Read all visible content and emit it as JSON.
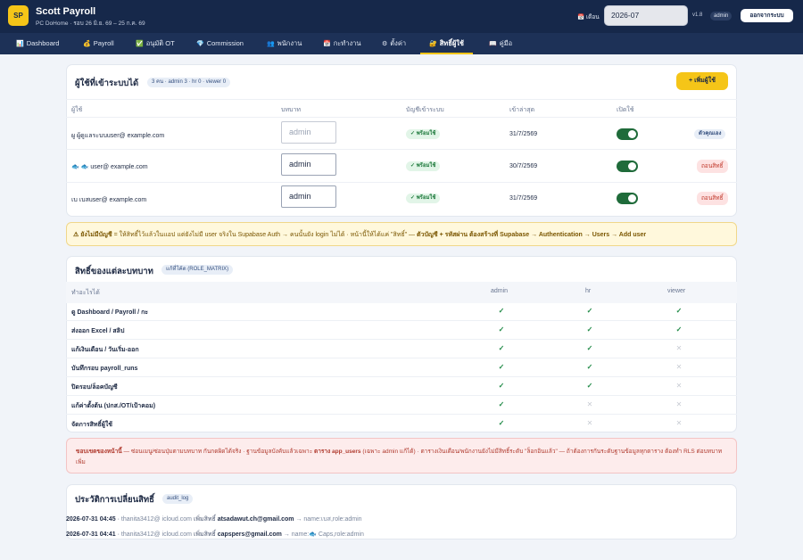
{
  "header": {
    "logo": "SP",
    "title": "Scott Payroll",
    "subtitle": "PC DoHome · รอบ 26 มิ.ย. 69 – 25 ก.ค. 69",
    "month_label": "เดือน",
    "month_value": "2026-07",
    "version": "v1.8",
    "role": "admin",
    "logout": "ออกจากระบบ"
  },
  "nav": [
    {
      "icon": "📊",
      "label": "Dashboard",
      "active": false
    },
    {
      "icon": "💰",
      "label": "Payroll",
      "active": false
    },
    {
      "icon": "✅",
      "label": "อนุมัติ OT",
      "active": false
    },
    {
      "icon": "💎",
      "label": "Commission",
      "active": false
    },
    {
      "icon": "👥",
      "label": "พนักงาน",
      "active": false
    },
    {
      "icon": "📅",
      "label": "กะทำงาน",
      "active": false
    },
    {
      "icon": "⚙",
      "label": "ตั้งค่า",
      "active": false
    },
    {
      "icon": "🔐",
      "label": "สิทธิ์ผู้ใช้",
      "active": true
    },
    {
      "icon": "📖",
      "label": "คู่มือ",
      "active": false
    }
  ],
  "users": {
    "title": "ผู้ใช้ที่เข้าระบบได้",
    "summary": "3 คน · admin 3 · hr 0 · viewer 0",
    "add_button": "+ เพิ่มผู้ใช้",
    "columns": [
      "ผู้ใช้",
      "บทบาท",
      "บัญชีเข้าระบบ",
      "เข้าล่าสุด",
      "เปิดใช้"
    ],
    "rows": [
      {
        "user": "ผู ผู้ดูแลระบบuser@ example.com",
        "role": "admin",
        "role_placeholder": true,
        "status": "✓ พร้อมใช้",
        "last": "31/7/2569",
        "action": "ตัวคุณเอง",
        "action_type": "self"
      },
      {
        "user": "🐟 🐟 user@ example.com",
        "role": "admin",
        "role_placeholder": false,
        "status": "✓ พร้อมใช้",
        "last": "30/7/2569",
        "action": "ถอนสิทธิ์",
        "action_type": "revoke"
      },
      {
        "user": "เบ เบสuser@ example.com",
        "role": "admin",
        "role_placeholder": false,
        "status": "✓ พร้อมใช้",
        "last": "31/7/2569",
        "action": "ถอนสิทธิ์",
        "action_type": "revoke"
      }
    ]
  },
  "warning": {
    "lead": "⚠ ยังไม่มีบัญชี",
    "text": " = ให้สิทธิ์ไว้แล้วในแอป แต่ยังไม่มี user จริงใน Supabase Auth → คนนั้นยัง login ไม่ได้ · หน้านี้ให้ได้แค่ \"สิทธิ์\" — ",
    "bold": "ตัวบัญชี + รหัสผ่าน ต้องสร้างที่ Supabase → Authentication → Users → Add user"
  },
  "matrix": {
    "title": "สิทธิ์ของแต่ละบทบาท",
    "tag": "แก้ที่โค้ด (ROLE_MATRIX)",
    "columns": [
      "ทำอะไรได้",
      "admin",
      "hr",
      "viewer"
    ],
    "rows": [
      {
        "label": "ดู Dashboard / Payroll / กะ",
        "admin": "✓",
        "hr": "✓",
        "viewer": "✓"
      },
      {
        "label": "ส่งออก Excel / สลิป",
        "admin": "✓",
        "hr": "✓",
        "viewer": "✓"
      },
      {
        "label": "แก้เงินเดือน / วันเริ่ม-ออก",
        "admin": "✓",
        "hr": "✓",
        "viewer": "✕"
      },
      {
        "label": "บันทึกรอบ payroll_runs",
        "admin": "✓",
        "hr": "✓",
        "viewer": "✕"
      },
      {
        "label": "ปิดรอบ/ล็อคบัญชี",
        "admin": "✓",
        "hr": "✓",
        "viewer": "✕"
      },
      {
        "label": "แก้ค่าตั้งต้น (ปกส./OT/เป้าคอม)",
        "admin": "✓",
        "hr": "✕",
        "viewer": "✕"
      },
      {
        "label": "จัดการสิทธิ์ผู้ใช้",
        "admin": "✓",
        "hr": "✕",
        "viewer": "✕"
      }
    ]
  },
  "note": {
    "lead": "ขอบเขตของหน้านี้",
    "text1": " — ซ่อนเมนู/ซ่อนปุ่มตามบทบาท กันกดผิดได้จริง · ฐานข้อมูลบังคับแล้วเฉพาะ ",
    "bold2": "ตาราง app_users",
    "text2": " (เฉพาะ admin แก้ได้) · ตารางเงินเดือน/พนักงานยังไม่มีสิทธิ์ระดับ \"ล็อกอินแล้ว\" — ถ้าต้องการกันระดับฐานข้อมูลทุกตาราง ต้องทำ RLS ต่อบทบาทเพิ่ม"
  },
  "audit": {
    "title": "ประวัติการเปลี่ยนสิทธิ์",
    "tag": "audit_log",
    "entries": [
      {
        "ts": "2026-07-31 04:45",
        "actor": "thanita3412@ icloud.com",
        "action": "เพิ่มสิทธิ์",
        "email": "atsadawut.ch@gmail.com",
        "result": "→ name:เบส,role:admin"
      },
      {
        "ts": "2026-07-31 04:41",
        "actor": "thanita3412@ icloud.com",
        "action": "เพิ่มสิทธิ์",
        "email": "capspers@gmail.com",
        "result": "→ name:🐟 Caps,role:admin"
      }
    ]
  },
  "colors": {
    "navy": "#16284a",
    "accent": "#f5c518",
    "success": "#1f8a46",
    "danger": "#c0392b"
  }
}
